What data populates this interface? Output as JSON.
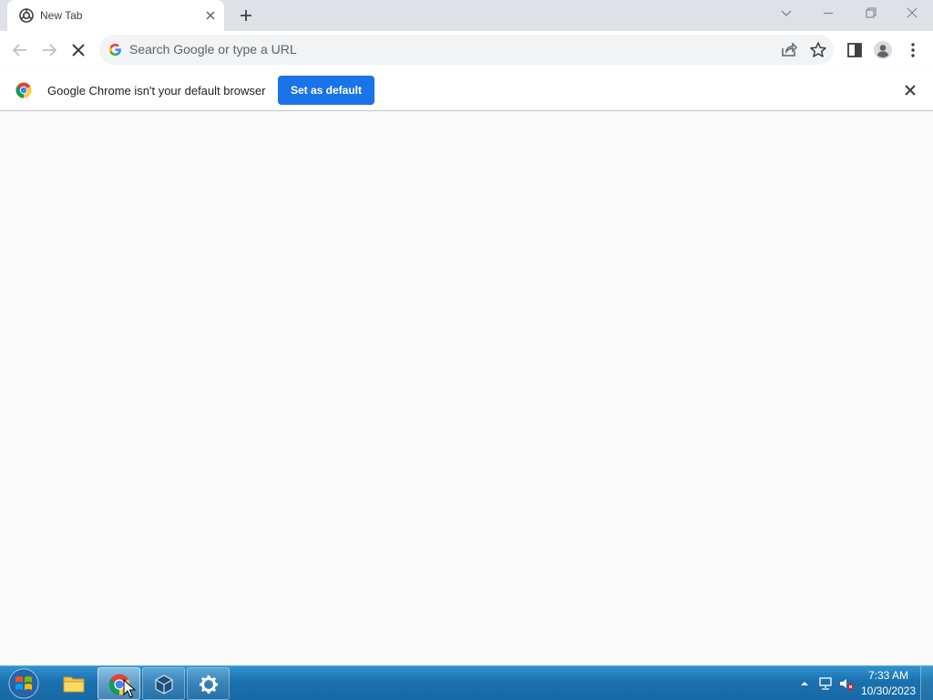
{
  "tab": {
    "title": "New Tab"
  },
  "omnibox": {
    "placeholder": "Search Google or type a URL"
  },
  "infobar": {
    "message": "Google Chrome isn't your default browser",
    "button_label": "Set as default"
  },
  "taskbar": {
    "time": "7:33 AM",
    "date": "10/30/2023"
  },
  "colors": {
    "accent": "#1a73e8",
    "tabstrip": "#dee1e6",
    "taskbar": "#1b70ad"
  },
  "icons": [
    "chrome-icon",
    "close-icon",
    "plus-icon",
    "back-icon",
    "forward-icon",
    "stop-icon",
    "google-icon",
    "share-icon",
    "star-icon",
    "side-panel-icon",
    "profile-icon",
    "menu-icon",
    "windows-start-icon",
    "file-explorer-icon",
    "virtualbox-icon",
    "settings-icon"
  ]
}
